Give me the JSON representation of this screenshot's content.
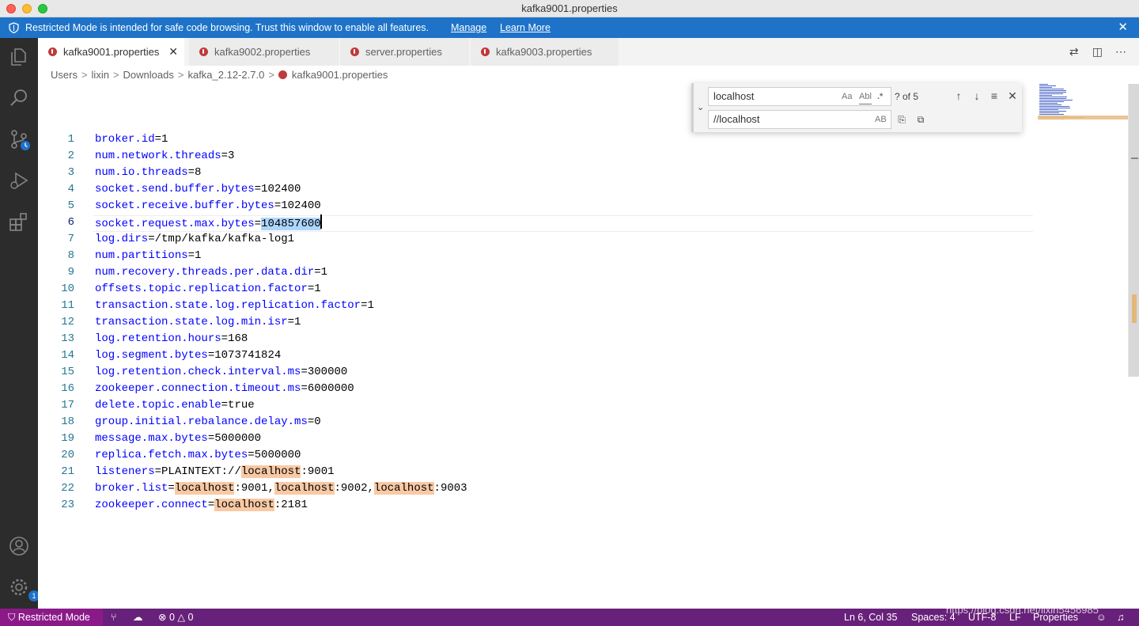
{
  "window": {
    "title": "kafka9001.properties"
  },
  "banner": {
    "text": "Restricted Mode is intended for safe code browsing. Trust this window to enable all features.",
    "manage_label": "Manage",
    "learn_more_label": "Learn More",
    "close_glyph": "✕",
    "color": "#1e73c8"
  },
  "activity_bar": {
    "items": [
      {
        "name": "explorer-icon"
      },
      {
        "name": "search-icon"
      },
      {
        "name": "source-control-icon"
      },
      {
        "name": "run-debug-icon"
      },
      {
        "name": "extensions-icon"
      },
      {
        "name": "accounts-icon"
      },
      {
        "name": "settings-gear-icon",
        "badge": "1"
      }
    ]
  },
  "tabs": [
    {
      "label": "kafka9001.properties",
      "active": true,
      "close": "✕"
    },
    {
      "label": "kafka9002.properties",
      "active": false
    },
    {
      "label": "server.properties",
      "active": false
    },
    {
      "label": "kafka9003.properties",
      "active": false
    }
  ],
  "breadcrumb": {
    "parts": [
      "Users",
      "lixin",
      "Downloads",
      "kafka_2.12-2.7.0"
    ],
    "file": "kafka9001.properties",
    "separator": ">"
  },
  "find_widget": {
    "find_value": "localhost",
    "replace_value": "//localhost",
    "count": "? of 5",
    "match_case": "Aa",
    "whole_word": "Abl",
    "regex": ".*",
    "preserve_case": "AB"
  },
  "editor": {
    "current_line": 6,
    "lines": [
      {
        "n": "1",
        "key": "broker.id",
        "val": "1"
      },
      {
        "n": "2",
        "key": "num.network.threads",
        "val": "3"
      },
      {
        "n": "3",
        "key": "num.io.threads",
        "val": "8"
      },
      {
        "n": "4",
        "key": "socket.send.buffer.bytes",
        "val": "102400"
      },
      {
        "n": "5",
        "key": "socket.receive.buffer.bytes",
        "val": "102400"
      },
      {
        "n": "6",
        "key": "socket.request.max.bytes",
        "val": "104857600"
      },
      {
        "n": "7",
        "key": "log.dirs",
        "val": "/tmp/kafka/kafka-log1"
      },
      {
        "n": "8",
        "key": "num.partitions",
        "val": "1"
      },
      {
        "n": "9",
        "key": "num.recovery.threads.per.data.dir",
        "val": "1"
      },
      {
        "n": "10",
        "key": "offsets.topic.replication.factor",
        "val": "1"
      },
      {
        "n": "11",
        "key": "transaction.state.log.replication.factor",
        "val": "1"
      },
      {
        "n": "12",
        "key": "transaction.state.log.min.isr",
        "val": "1"
      },
      {
        "n": "13",
        "key": "log.retention.hours",
        "val": "168"
      },
      {
        "n": "14",
        "key": "log.segment.bytes",
        "val": "1073741824"
      },
      {
        "n": "15",
        "key": "log.retention.check.interval.ms",
        "val": "300000"
      },
      {
        "n": "16",
        "key": "zookeeper.connection.timeout.ms",
        "val": "6000000"
      },
      {
        "n": "17",
        "key": "delete.topic.enable",
        "val": "true"
      },
      {
        "n": "18",
        "key": "group.initial.rebalance.delay.ms",
        "val": "0"
      },
      {
        "n": "19",
        "key": "message.max.bytes",
        "val": "5000000"
      },
      {
        "n": "20",
        "key": "replica.fetch.max.bytes",
        "val": "5000000"
      },
      {
        "n": "21",
        "key": "listeners",
        "val_parts": [
          "PLAINTEXT://",
          "localhost",
          ":9001"
        ]
      },
      {
        "n": "22",
        "key": "broker.list",
        "val_parts": [
          "localhost",
          ":9001,",
          "localhost",
          ":9002,",
          "localhost",
          ":9003"
        ]
      },
      {
        "n": "23",
        "key": "zookeeper.connect",
        "val_parts": [
          "localhost",
          ":2181"
        ]
      }
    ]
  },
  "status_bar": {
    "restricted_label": "Restricted Mode",
    "errors": "0",
    "warnings": "0",
    "position": "Ln 6, Col 35",
    "spaces": "Spaces: 4",
    "encoding": "UTF-8",
    "eol": "LF",
    "language": "Properties",
    "color": "#68217a"
  },
  "watermark": "https://blog.csdn.net/lixin5456985"
}
